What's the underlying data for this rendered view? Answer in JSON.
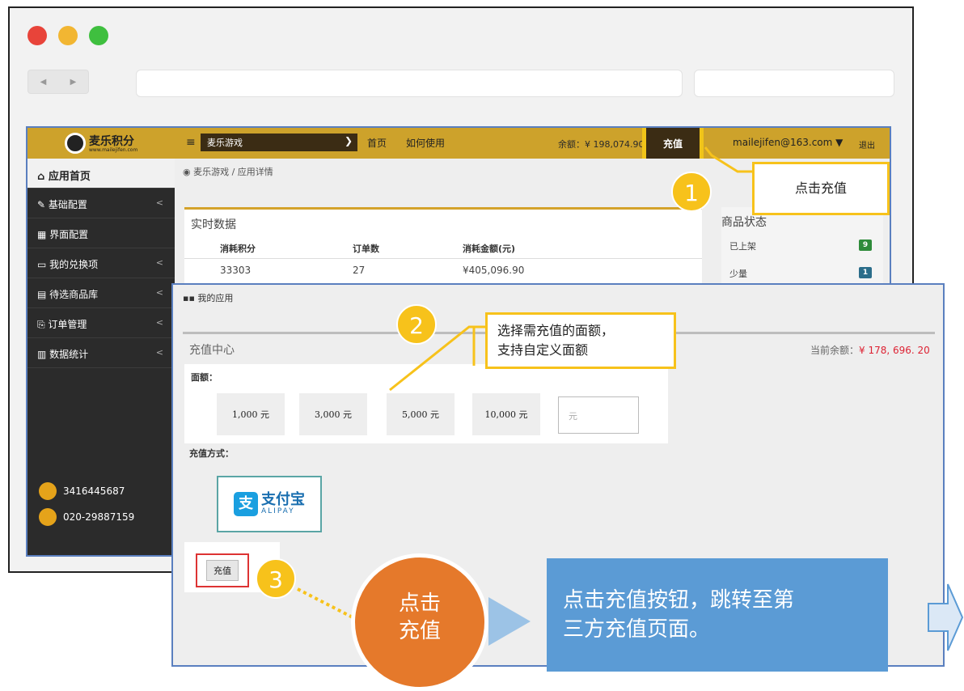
{
  "browser": {
    "nav_back": "◀",
    "nav_forward": "▶"
  },
  "app": {
    "logo_text": "麦乐积分",
    "logo_sub": "www.mailejifen.com",
    "game_select": "麦乐游戏",
    "nav": [
      "首页",
      "如何使用"
    ],
    "balance": "余额：¥ 198,074.90",
    "recharge": "充值",
    "email": "mailejifen@163.com",
    "logout": "退出",
    "sidebar": [
      {
        "label": "应用首页"
      },
      {
        "label": "基础配置"
      },
      {
        "label": "界面配置"
      },
      {
        "label": "我的兑换项"
      },
      {
        "label": "待选商品库"
      },
      {
        "label": "订单管理"
      },
      {
        "label": "数据统计"
      }
    ],
    "contact_qq": "3416445687",
    "contact_phone": "020-29887159",
    "breadcrumb": "麦乐游戏 / 应用详情",
    "realtime_title": "实时数据",
    "table_headers": [
      "消耗积分",
      "订单数",
      "消耗金额(元)"
    ],
    "table_row": [
      "33303",
      "27",
      "¥405,096.90"
    ],
    "status_title": "商品状态",
    "status_rows": [
      {
        "label": "已上架",
        "count": "9"
      },
      {
        "label": "少量",
        "count": "1"
      }
    ]
  },
  "recharge_page": {
    "my_app": "我的应用",
    "title": "充值中心",
    "current_balance_label": "当前余额：",
    "current_balance": "¥ 178, 696. 20",
    "amount_label": "面额：",
    "amounts": [
      "1,000 元",
      "3,000 元",
      "5,000 元",
      "10,000 元"
    ],
    "amount_placeholder": "元",
    "pay_method_label": "充值方式：",
    "alipay_cn": "支付宝",
    "alipay_en": "ALIPAY",
    "recharge_button": "充值"
  },
  "annotations": {
    "step1": "1",
    "step1_text": "点击充值",
    "step2": "2",
    "step2_text_line1": "选择需充值的面额，",
    "step2_text_line2": "支持自定义面额",
    "step3": "3",
    "circle_line1": "点击",
    "circle_line2": "充值",
    "summary_line1": "点击充值按钮，跳转至第",
    "summary_line2": "三方充值页面。"
  },
  "colors": {
    "accent": "#cda22b",
    "highlight": "#f7c21b",
    "orange": "#e5792b",
    "blue": "#5b9bd5"
  }
}
